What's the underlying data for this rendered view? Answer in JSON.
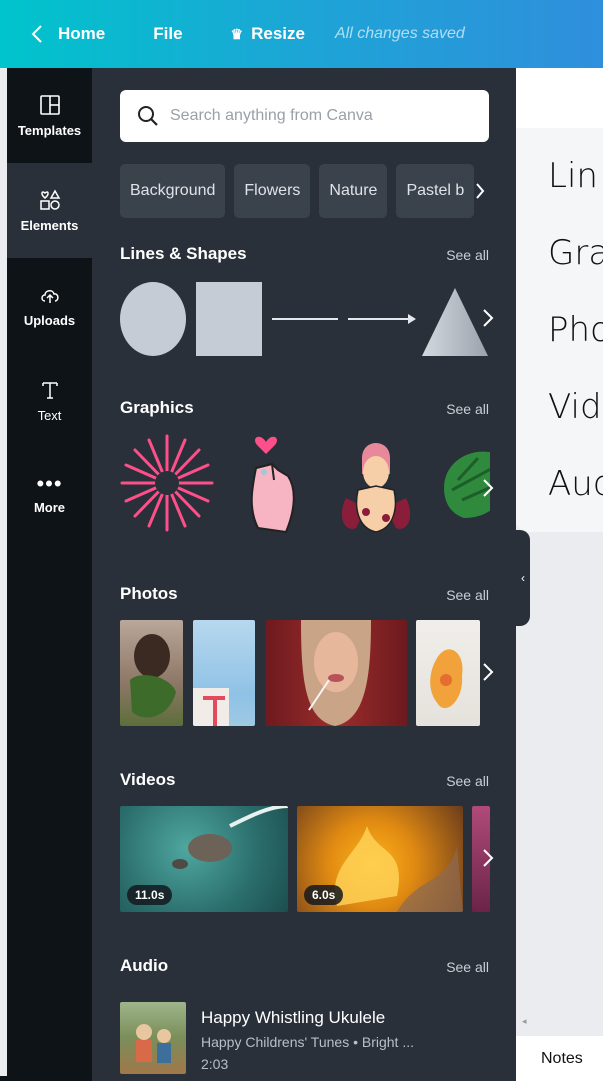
{
  "topbar": {
    "home_label": "Home",
    "file_label": "File",
    "resize_label": "Resize",
    "saved_status": "All changes saved"
  },
  "rail": {
    "items": [
      {
        "label": "Templates",
        "icon": "templates-icon"
      },
      {
        "label": "Elements",
        "icon": "elements-icon"
      },
      {
        "label": "Uploads",
        "icon": "upload-cloud-icon"
      },
      {
        "label": "Text",
        "icon": "text-icon"
      },
      {
        "label": "More",
        "icon": "more-icon"
      }
    ]
  },
  "search": {
    "placeholder": "Search anything from Canva",
    "value": ""
  },
  "chips": [
    "Background",
    "Flowers",
    "Nature",
    "Pastel b"
  ],
  "sections": {
    "lines_shapes": {
      "title": "Lines & Shapes",
      "see_all": "See all"
    },
    "graphics": {
      "title": "Graphics",
      "see_all": "See all"
    },
    "photos": {
      "title": "Photos",
      "see_all": "See all"
    },
    "videos": {
      "title": "Videos",
      "see_all": "See all",
      "durations": [
        "11.0s",
        "6.0s"
      ]
    },
    "audio": {
      "title": "Audio",
      "see_all": "See all"
    }
  },
  "audio_item": {
    "title": "Happy Whistling Ukulele",
    "subtitle": "Happy Childrens' Tunes • Bright ...",
    "duration": "2:03"
  },
  "page": {
    "lines": [
      "Lin",
      "Gra",
      "Pho",
      "Vid",
      "Aud"
    ]
  },
  "footer": {
    "notes_label": "Notes"
  },
  "colors": {
    "topbar_start": "#00c4cc",
    "topbar_end": "#2f8fdc",
    "panel_bg": "#293039",
    "rail_bg": "#0e1318",
    "pink": "#ff4f8b"
  }
}
